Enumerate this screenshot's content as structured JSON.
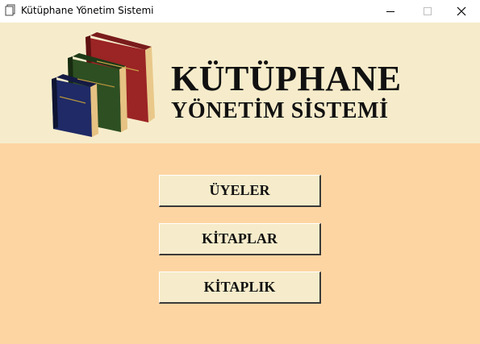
{
  "window": {
    "title": "Kütüphane Yönetim Sistemi",
    "icon": "app-window-icon"
  },
  "header": {
    "title": "KÜTÜPHANE",
    "subtitle": "YÖNETİM SİSTEMİ",
    "logo_icon": "books-stack-icon"
  },
  "menu": {
    "members_label": "ÜYELER",
    "books_label": "KİTAPLAR",
    "library_label": "KİTAPLIK"
  },
  "colors": {
    "header_bg": "#f6eccb",
    "main_bg": "#fdd5a2",
    "button_bg": "#f6eccb"
  }
}
